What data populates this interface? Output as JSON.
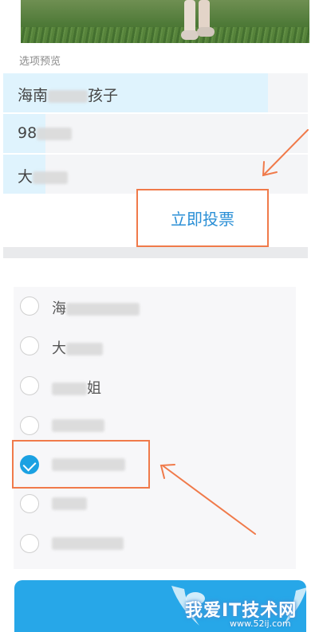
{
  "section_title": "选项预览",
  "preview": [
    {
      "prefix": "海南",
      "suffix": "孩子",
      "fill_fraction": 0.87
    },
    {
      "prefix": "98",
      "suffix": "",
      "fill_fraction": 0.14
    },
    {
      "prefix": "大",
      "suffix": "",
      "fill_fraction": 0.14
    }
  ],
  "vote_now_label": "立即投票",
  "options": [
    {
      "text": "海",
      "checked": false
    },
    {
      "text": "大",
      "checked": false
    },
    {
      "text": "姐",
      "checked": false
    },
    {
      "text": "",
      "checked": false
    },
    {
      "text": "",
      "checked": true
    },
    {
      "text": "",
      "checked": false
    },
    {
      "text": "",
      "checked": false
    }
  ],
  "watermark": {
    "title": "我爱IT技术网",
    "url": "www.52ij.com"
  },
  "colors": {
    "accent": "#1ba1e2",
    "annotation": "#f07a4a",
    "bar": "#dff3fd"
  }
}
